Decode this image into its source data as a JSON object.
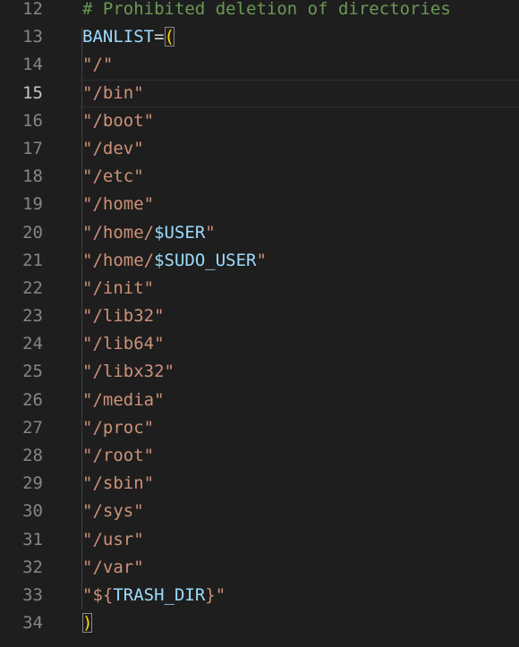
{
  "editor": {
    "colors": {
      "background": "#1e1e1e",
      "line_number": "#858585",
      "line_number_active": "#c6c6c6",
      "comment": "#6a9955",
      "variable": "#9cdcfe",
      "string": "#ce9178",
      "bracket": "#ffd700"
    },
    "active_line": "15",
    "lines": [
      {
        "number": "12",
        "tokens": [
          {
            "type": "comment",
            "text": "# Prohibited deletion of directories"
          }
        ]
      },
      {
        "number": "13",
        "tokens": [
          {
            "type": "variable",
            "text": "BANLIST"
          },
          {
            "type": "operator",
            "text": "="
          },
          {
            "type": "paren",
            "text": "("
          }
        ]
      },
      {
        "number": "14",
        "tokens": [
          {
            "type": "string",
            "text": "\"/\""
          }
        ]
      },
      {
        "number": "15",
        "tokens": [
          {
            "type": "string",
            "text": "\"/bin\""
          }
        ]
      },
      {
        "number": "16",
        "tokens": [
          {
            "type": "string",
            "text": "\"/boot\""
          }
        ]
      },
      {
        "number": "17",
        "tokens": [
          {
            "type": "string",
            "text": "\"/dev\""
          }
        ]
      },
      {
        "number": "18",
        "tokens": [
          {
            "type": "string",
            "text": "\"/etc\""
          }
        ]
      },
      {
        "number": "19",
        "tokens": [
          {
            "type": "string",
            "text": "\"/home\""
          }
        ]
      },
      {
        "number": "20",
        "tokens": [
          {
            "type": "string",
            "text": "\"/home/"
          },
          {
            "type": "variable",
            "text": "$USER"
          },
          {
            "type": "string",
            "text": "\""
          }
        ]
      },
      {
        "number": "21",
        "tokens": [
          {
            "type": "string",
            "text": "\"/home/"
          },
          {
            "type": "variable",
            "text": "$SUDO_USER"
          },
          {
            "type": "string",
            "text": "\""
          }
        ]
      },
      {
        "number": "22",
        "tokens": [
          {
            "type": "string",
            "text": "\"/init\""
          }
        ]
      },
      {
        "number": "23",
        "tokens": [
          {
            "type": "string",
            "text": "\"/lib32\""
          }
        ]
      },
      {
        "number": "24",
        "tokens": [
          {
            "type": "string",
            "text": "\"/lib64\""
          }
        ]
      },
      {
        "number": "25",
        "tokens": [
          {
            "type": "string",
            "text": "\"/libx32\""
          }
        ]
      },
      {
        "number": "26",
        "tokens": [
          {
            "type": "string",
            "text": "\"/media\""
          }
        ]
      },
      {
        "number": "27",
        "tokens": [
          {
            "type": "string",
            "text": "\"/proc\""
          }
        ]
      },
      {
        "number": "28",
        "tokens": [
          {
            "type": "string",
            "text": "\"/root\""
          }
        ]
      },
      {
        "number": "29",
        "tokens": [
          {
            "type": "string",
            "text": "\"/sbin\""
          }
        ]
      },
      {
        "number": "30",
        "tokens": [
          {
            "type": "string",
            "text": "\"/sys\""
          }
        ]
      },
      {
        "number": "31",
        "tokens": [
          {
            "type": "string",
            "text": "\"/usr\""
          }
        ]
      },
      {
        "number": "32",
        "tokens": [
          {
            "type": "string",
            "text": "\"/var\""
          }
        ]
      },
      {
        "number": "33",
        "tokens": [
          {
            "type": "string",
            "text": "\"${"
          },
          {
            "type": "variable",
            "text": "TRASH_DIR"
          },
          {
            "type": "string",
            "text": "}\""
          }
        ]
      },
      {
        "number": "34",
        "tokens": [
          {
            "type": "paren",
            "text": ")"
          }
        ]
      }
    ]
  }
}
